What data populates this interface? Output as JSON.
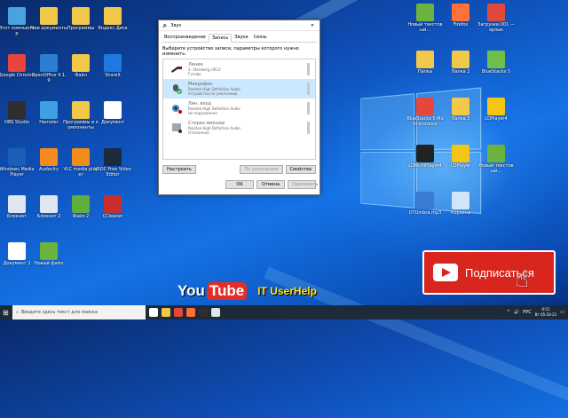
{
  "desktop_icons_left": [
    {
      "label": "Этот компьютер",
      "color": "#4aa3df"
    },
    {
      "label": "Мои документы",
      "color": "#f2c84b"
    },
    {
      "label": "Программы",
      "color": "#f2c84b"
    },
    {
      "label": "Яндекс Диск",
      "color": "#f2c84b"
    },
    {
      "label": "Google Chrome",
      "color": "#e8453c"
    },
    {
      "label": "OpenOffice 4.1.9",
      "color": "#2b7fd3"
    },
    {
      "label": "Файл",
      "color": "#f2c84b"
    },
    {
      "label": "ShareIt",
      "color": "#1f7ae0"
    },
    {
      "label": "OBS Studio",
      "color": "#302e31"
    },
    {
      "label": "Hamster",
      "color": "#3ea0e0"
    },
    {
      "label": "Программы и компоненты",
      "color": "#f2c84b"
    },
    {
      "label": "Документ",
      "color": "#ffffff"
    },
    {
      "label": "Windows Media Player",
      "color": "#1b5fb8"
    },
    {
      "label": "Audacity",
      "color": "#f58a1f"
    },
    {
      "label": "VLC media player",
      "color": "#f28c1a"
    },
    {
      "label": "VSDC Free Video Editor",
      "color": "#1e2b3d"
    },
    {
      "label": "Блокнот",
      "color": "#dfe6ee"
    },
    {
      "label": "Блокнот 2",
      "color": "#dfe6ee"
    },
    {
      "label": "Файл 2",
      "color": "#5fae3e"
    },
    {
      "label": "CCleaner",
      "color": "#c9302c"
    },
    {
      "label": "Документ 2",
      "color": "#ffffff"
    },
    {
      "label": "Новый файл",
      "color": "#6bb33e"
    }
  ],
  "desktop_icons_right": [
    {
      "label": "Новый текстовый...",
      "color": "#6bb33e"
    },
    {
      "label": "Firefox",
      "color": "#ff7139"
    },
    {
      "label": "Загрузки.001 — ярлык",
      "color": "#e04a3d"
    },
    {
      "label": "Папка",
      "color": "#f2c84b"
    },
    {
      "label": "Папка 2",
      "color": "#f2c84b"
    },
    {
      "label": "BlueStacks 5",
      "color": "#6fc04a"
    },
    {
      "label": "BlueStacks 5 Multi-Instance",
      "color": "#e8453c"
    },
    {
      "label": "Папка 3",
      "color": "#f2c84b"
    },
    {
      "label": "LDPlayer4",
      "color": "#f6c413"
    },
    {
      "label": "LDMultiPlayer4",
      "color": "#222222"
    },
    {
      "label": "LDPlayer",
      "color": "#f6c413"
    },
    {
      "label": "Новый текстовый...",
      "color": "#6bb33e"
    },
    {
      "label": "OTUmbra.mp3",
      "color": "#3a7bd5"
    },
    {
      "label": "Корзина",
      "color": "#cfe6f7"
    }
  ],
  "dialog": {
    "title": "Звук",
    "close": "✕",
    "tabs": [
      "Воспроизведение",
      "Запись",
      "Звуки",
      "Связь"
    ],
    "active_tab": 1,
    "instruction": "Выберите устройство записи, параметры которого нужно изменить:",
    "devices": [
      {
        "name": "Линия",
        "desc1": "2- Steinberg UR12",
        "desc2": "Готово"
      },
      {
        "name": "Микрофон",
        "desc1": "Realtek High Definition Audio",
        "desc2": "Устройство по умолчанию"
      },
      {
        "name": "Лин. вход",
        "desc1": "Realtek High Definition Audio",
        "desc2": "Не подключено"
      },
      {
        "name": "Стерео микшер",
        "desc1": "Realtek High Definition Audio",
        "desc2": "Отключено"
      }
    ],
    "configure": "Настроить",
    "default_btn": "По умолчанию",
    "properties": "Свойства",
    "ok": "OK",
    "cancel": "Отмена",
    "apply": "Применить"
  },
  "taskbar": {
    "search_placeholder": "Введите здесь текст для поиска",
    "lang": "РУС",
    "time": "0:51",
    "date": "Вт 05-10-21"
  },
  "branding": {
    "you": "You",
    "tube": "Tube",
    "channel": "IT UserHelp",
    "subscribe": "Подписаться"
  }
}
